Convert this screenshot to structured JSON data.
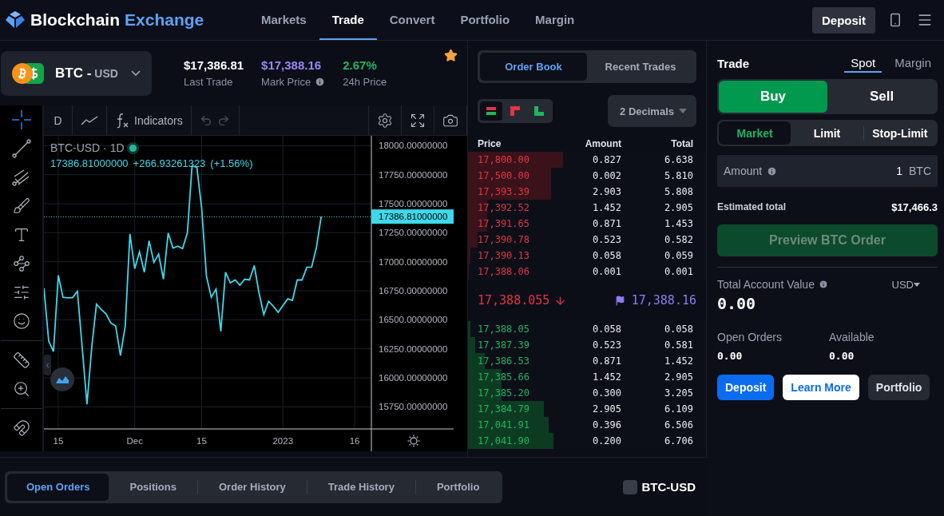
{
  "header": {
    "brand": "Blockchain",
    "brand_accent": "Exchange",
    "nav": [
      {
        "label": "Markets",
        "selected": false
      },
      {
        "label": "Trade",
        "selected": true
      },
      {
        "label": "Convert",
        "selected": false
      },
      {
        "label": "Portfolio",
        "selected": false
      },
      {
        "label": "Margin",
        "selected": false
      }
    ],
    "deposit": "Deposit"
  },
  "market": {
    "base": "BTC -",
    "quote": "USD",
    "favorite": true,
    "stats": [
      {
        "value": "$17,386.81",
        "label": "Last Trade",
        "kind": "plain",
        "info": false
      },
      {
        "value": "$17,388.16",
        "label": "Mark Price",
        "kind": "mark",
        "info": true
      },
      {
        "value": "2.67%",
        "label": "24h Price",
        "kind": "change",
        "info": false
      }
    ]
  },
  "chart": {
    "interval": "D",
    "indicators": "Indicators",
    "symbol": "BTC-USD · 1D",
    "live": true,
    "last": "17386.81000000",
    "change": "+266.93261323",
    "change_pct": "(+1.56%)",
    "price_tag": "17386.81000000",
    "chart_data": {
      "type": "line",
      "categories": [
        null,
        null,
        null,
        "15",
        null,
        null,
        null,
        null,
        null,
        null,
        null,
        null,
        null,
        null,
        null,
        null,
        null,
        null,
        null,
        "Dec",
        null,
        null,
        null,
        null,
        null,
        null,
        null,
        null,
        null,
        null,
        null,
        null,
        null,
        "15",
        null,
        null,
        null,
        null,
        null,
        null,
        null,
        null,
        null,
        null,
        null,
        null,
        null,
        null,
        null,
        null,
        "2023",
        null,
        null,
        null,
        null,
        null,
        null,
        null,
        null,
        null,
        null,
        null,
        null,
        null,
        null,
        "16",
        null,
        null,
        null
      ],
      "series": [
        {
          "color": "#3fd8ea",
          "values": [
            16772,
            16317,
            16226,
            16884,
            16694,
            16690,
            16692,
            16746,
            16265,
            15771,
            16265,
            16634,
            16590,
            16551,
            16473,
            16447,
            16192,
            16447,
            17240,
            16941,
            17085,
            16910,
            17181,
            16994,
            17066,
            16850,
            17248,
            17118,
            17134,
            17113,
            17248,
            17826,
            17813,
            17462,
            16876,
            16694,
            16764,
            16400,
            16910,
            16817,
            16843,
            16798,
            16850,
            16843,
            16967,
            16733,
            16546,
            16660,
            16616,
            16564,
            16624,
            16681,
            16668,
            16843,
            16843,
            16952,
            16954,
            17124,
            17389,
            null,
            null,
            null,
            null,
            null,
            null,
            null,
            null,
            null,
            null
          ]
        }
      ],
      "ylim": [
        15560,
        18085
      ],
      "grid": true,
      "ref_lines": [
        {
          "axis": "y",
          "value": 17386.81
        }
      ],
      "yticks": [
        {
          "value": 18000,
          "label": "18000.00000000"
        },
        {
          "value": 17750,
          "label": "17750.00000000"
        },
        {
          "value": 17500,
          "label": "17500.00000000"
        },
        {
          "value": 17250,
          "label": "17250.00000000"
        },
        {
          "value": 17000,
          "label": "17000.00000000"
        },
        {
          "value": 16750,
          "label": "16750.00000000"
        },
        {
          "value": 16500,
          "label": "16500.00000000"
        },
        {
          "value": 16250,
          "label": "16250.00000000"
        },
        {
          "value": 16000,
          "label": "16000.00000000"
        },
        {
          "value": 15750,
          "label": "15750.00000000"
        }
      ]
    }
  },
  "order_book": {
    "tabs": [
      {
        "label": "Order Book",
        "selected": true
      },
      {
        "label": "Recent Trades",
        "selected": false
      }
    ],
    "views": [
      {
        "kind": "both",
        "selected": true
      },
      {
        "kind": "asks",
        "selected": false
      },
      {
        "kind": "bids",
        "selected": false
      }
    ],
    "decimals": "2 Decimals",
    "columns": [
      "Price",
      "Amount",
      "Total"
    ],
    "asks": [
      {
        "price": "17,800.00",
        "amount": "0.827",
        "total": "6.638",
        "level": 0.4
      },
      {
        "price": "17,500.00",
        "amount": "0.002",
        "total": "5.810",
        "level": 0.35
      },
      {
        "price": "17,393.39",
        "amount": "2.903",
        "total": "5.808",
        "level": 0.35
      },
      {
        "price": "17,392.52",
        "amount": "1.452",
        "total": "2.905",
        "level": 0.08
      },
      {
        "price": "17,391.65",
        "amount": "0.871",
        "total": "1.453",
        "level": 0.08
      },
      {
        "price": "17,390.78",
        "amount": "0.523",
        "total": "0.582",
        "level": 0.04
      },
      {
        "price": "17,390.13",
        "amount": "0.058",
        "total": "0.059",
        "level": 0.01
      },
      {
        "price": "17,388.06",
        "amount": "0.001",
        "total": "0.001",
        "level": 0.005
      }
    ],
    "spread": {
      "price": "17,388.055",
      "mark": "17,388.16"
    },
    "bids": [
      {
        "price": "17,388.05",
        "amount": "0.058",
        "total": "0.058",
        "level": 0.01
      },
      {
        "price": "17,387.39",
        "amount": "0.523",
        "total": "0.581",
        "level": 0.03
      },
      {
        "price": "17,386.53",
        "amount": "0.871",
        "total": "1.452",
        "level": 0.07
      },
      {
        "price": "17,385.66",
        "amount": "1.452",
        "total": "2.905",
        "level": 0.14
      },
      {
        "price": "17,385.20",
        "amount": "0.300",
        "total": "3.205",
        "level": 0.14
      },
      {
        "price": "17,384.79",
        "amount": "2.905",
        "total": "6.109",
        "level": 0.32
      },
      {
        "price": "17,041.91",
        "amount": "0.396",
        "total": "6.506",
        "level": 0.34
      },
      {
        "price": "17,041.90",
        "amount": "0.200",
        "total": "6.706",
        "level": 0.36
      }
    ]
  },
  "trade": {
    "title": "Trade",
    "modes": [
      {
        "label": "Spot",
        "selected": true
      },
      {
        "label": "Margin",
        "selected": false
      }
    ],
    "sides": [
      {
        "label": "Buy",
        "selected": true
      },
      {
        "label": "Sell",
        "selected": false
      }
    ],
    "order_types": [
      {
        "label": "Market",
        "selected": true
      },
      {
        "label": "Limit",
        "selected": false
      },
      {
        "label": "Stop-Limit",
        "selected": false
      }
    ],
    "amount": {
      "label": "Amount",
      "value": "1",
      "unit": "BTC"
    },
    "estimate": {
      "label": "Estimated total",
      "value": "$17,466.3"
    },
    "preview": {
      "label": "Preview BTC Order",
      "disabled": true
    },
    "account": {
      "label": "Total Account Value",
      "currency": "USD",
      "value": "0.00"
    },
    "balances": [
      {
        "label": "Open Orders",
        "value": "0.00"
      },
      {
        "label": "Available",
        "value": "0.00"
      }
    ],
    "actions": [
      {
        "label": "Deposit",
        "kind": "primary"
      },
      {
        "label": "Learn More",
        "kind": "light"
      },
      {
        "label": "Portfolio",
        "kind": "dark"
      }
    ]
  },
  "bottom": {
    "tabs": [
      {
        "label": "Open Orders",
        "selected": true
      },
      {
        "label": "Positions",
        "selected": false
      },
      {
        "label": "Order History",
        "selected": false
      },
      {
        "label": "Trade History",
        "selected": false
      },
      {
        "label": "Portfolio",
        "selected": false
      }
    ],
    "filter": {
      "label": "BTC-USD",
      "checked": false
    }
  }
}
